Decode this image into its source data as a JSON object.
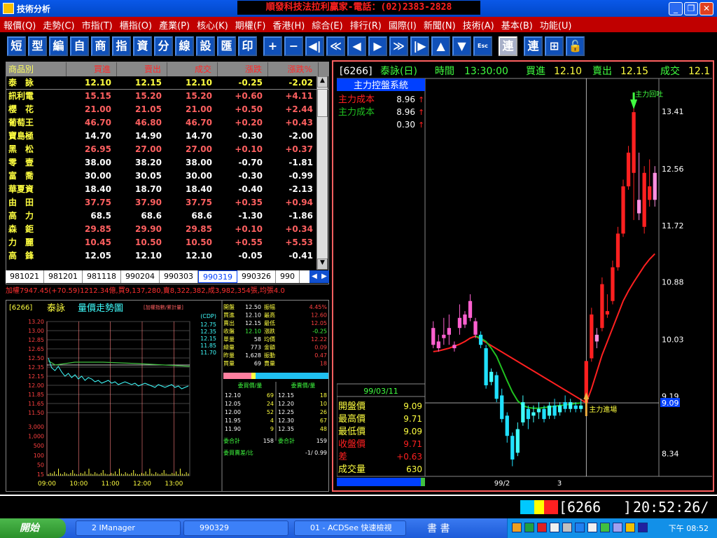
{
  "window": {
    "title": "技術分析",
    "banner": "順發科技法拉利贏家-電話：(02)2383-2828",
    "buttons": [
      "_",
      "❐",
      "✕"
    ]
  },
  "menu": [
    "報價(Q)",
    "走勢(C)",
    "市指(T)",
    "櫃指(O)",
    "產業(P)",
    "核心(K)",
    "期權(F)",
    "香港(H)",
    "綜合(E)",
    "排行(R)",
    "國際(I)",
    "新聞(N)",
    "技術(A)",
    "基本(B)",
    "功能(U)"
  ],
  "toolbar": [
    "短",
    "型",
    "編",
    "自",
    "商",
    "指",
    "資",
    "分",
    "線",
    "設",
    "匯",
    "印",
    "+",
    "−",
    "◀|",
    "≪",
    "◀",
    "▶",
    "≫",
    "|▶",
    "▲",
    "▼",
    "Esc",
    "連",
    "連",
    "⊞",
    "🔓"
  ],
  "quote_table": {
    "headers": [
      "商品別",
      "買進",
      "賣出",
      "成交",
      "漲跌",
      "漲跌%"
    ],
    "rows": [
      {
        "name": "泰　詠",
        "bid": "12.10",
        "ask": "12.15",
        "last": "12.10",
        "chg": "-0.25",
        "pct": "-2.02",
        "color": "#ffff40"
      },
      {
        "name": "訊利電",
        "bid": "15.15",
        "ask": "15.20",
        "last": "15.20",
        "chg": "+0.60",
        "pct": "+4.11",
        "color": "#ff6060"
      },
      {
        "name": "櫻　花",
        "bid": "21.00",
        "ask": "21.05",
        "last": "21.00",
        "chg": "+0.50",
        "pct": "+2.44",
        "color": "#ff6060"
      },
      {
        "name": "葡萄王",
        "bid": "46.70",
        "ask": "46.80",
        "last": "46.70",
        "chg": "+0.20",
        "pct": "+0.43",
        "color": "#ff6060"
      },
      {
        "name": "寶島極",
        "bid": "14.70",
        "ask": "14.90",
        "last": "14.70",
        "chg": "-0.30",
        "pct": "-2.00",
        "color": "#ffffff"
      },
      {
        "name": "黑　松",
        "bid": "26.95",
        "ask": "27.00",
        "last": "27.00",
        "chg": "+0.10",
        "pct": "+0.37",
        "color": "#ff6060"
      },
      {
        "name": "零　壹",
        "bid": "38.00",
        "ask": "38.20",
        "last": "38.00",
        "chg": "-0.70",
        "pct": "-1.81",
        "color": "#ffffff"
      },
      {
        "name": "富　喬",
        "bid": "30.00",
        "ask": "30.05",
        "last": "30.00",
        "chg": "-0.30",
        "pct": "-0.99",
        "color": "#ffffff"
      },
      {
        "name": "華夏資",
        "bid": "18.40",
        "ask": "18.70",
        "last": "18.40",
        "chg": "-0.40",
        "pct": "-2.13",
        "color": "#ffffff"
      },
      {
        "name": "由　田",
        "bid": "37.75",
        "ask": "37.90",
        "last": "37.75",
        "chg": "+0.35",
        "pct": "+0.94",
        "color": "#ff6060"
      },
      {
        "name": "高　力",
        "bid": "68.5",
        "ask": "68.6",
        "last": "68.6",
        "chg": "-1.30",
        "pct": "-1.86",
        "color": "#ffffff"
      },
      {
        "name": "森　鉅",
        "bid": "29.85",
        "ask": "29.90",
        "last": "29.85",
        "chg": "+0.10",
        "pct": "+0.34",
        "color": "#ff6060"
      },
      {
        "name": "力　麗",
        "bid": "10.45",
        "ask": "10.50",
        "last": "10.50",
        "chg": "+0.55",
        "pct": "+5.53",
        "color": "#ff6060"
      },
      {
        "name": "高　鋒",
        "bid": "12.05",
        "ask": "12.10",
        "last": "12.10",
        "chg": "-0.05",
        "pct": "-0.41",
        "color": "#ffffff"
      }
    ]
  },
  "date_tabs": [
    "981021",
    "981201",
    "981118",
    "990204",
    "990303",
    "990319",
    "990326",
    "990"
  ],
  "active_tab": "990319",
  "ticker_line": "加權7947.45(+70.59)1212.34億,買9,137,280,賣8,322,382,成3,982,354張,均張4.0",
  "tick_chart": {
    "code": "[6266]",
    "name": "泰詠",
    "title": "量價走勢圖",
    "subtitle": "[加權指數/累計量]",
    "cdp_label": "(CDP)",
    "cdp_values": [
      "12.75",
      "12.35",
      "12.15",
      "11.85",
      "11.70"
    ],
    "price_ticks": [
      "13.20",
      "13.00",
      "12.85",
      "12.65",
      "12.50",
      "12.35",
      "12.15",
      "12.00",
      "11.85",
      "11.65",
      "11.50"
    ],
    "volume_ticks": [
      "3,000",
      "1,000",
      "500",
      "100",
      "50",
      "15"
    ],
    "time_ticks": [
      "09:00",
      "10:00",
      "11:00",
      "12:00",
      "13:00"
    ],
    "stats": [
      [
        "開盤",
        "12.50",
        "振幅",
        "4.45%"
      ],
      [
        "買進",
        "12.10",
        "最高",
        "12.60"
      ],
      [
        "賣出",
        "12.15",
        "最低",
        "12.05"
      ],
      [
        "收盤",
        "12.10",
        "漲跌",
        "-0.25"
      ],
      [
        "單量",
        "58",
        "均價",
        "12.22"
      ],
      [
        "總量",
        "773",
        "金額",
        "0.09"
      ],
      [
        "昨量",
        "1,628",
        "振動",
        "0.47"
      ],
      [
        "買量",
        "",
        "賣量",
        "18"
      ]
    ],
    "buy_vol": "69",
    "bid_header": "委買價/量",
    "ask_header": "委賣價/量",
    "book": [
      [
        "12.10",
        "69",
        "12.15",
        "18"
      ],
      [
        "12.05",
        "24",
        "12.20",
        "10"
      ],
      [
        "12.00",
        "52",
        "12.25",
        "26"
      ],
      [
        "11.95",
        "4",
        "12.30",
        "67"
      ],
      [
        "11.90",
        "9",
        "12.35",
        "48"
      ]
    ],
    "bid_total_label": "委合計",
    "bid_total": "158",
    "ask_total_label": "委合計",
    "ask_total": "159",
    "ratio_label": "委買賣差/比",
    "ratio": "-1/ 0.99"
  },
  "kline": {
    "header": {
      "code": "[6266]",
      "name": "泰詠(日)",
      "time_label": "時間",
      "time": "13:30:00",
      "bid_label": "買進",
      "bid": "12.10",
      "ask_label": "賣出",
      "ask": "12.15",
      "last_label": "成交",
      "last": "12.1"
    },
    "system_title": "主力控盤系統",
    "legend": [
      {
        "label": "主力成本",
        "value": "8.96",
        "color": "#ff2020"
      },
      {
        "label": "主力成本",
        "value": "8.96",
        "color": "#20c020"
      },
      {
        "label": "",
        "value": "0.30",
        "color": "#ff2020"
      }
    ],
    "price_axis": [
      "13.41",
      "12.56",
      "11.72",
      "10.88",
      "10.03",
      "9.19",
      "9.09",
      "8.34"
    ],
    "current_price": "9.09",
    "annotations": {
      "return": "主力回吐",
      "entry": "主力進場"
    },
    "x_axis": [
      "99/2",
      "3"
    ],
    "info_date": "99/03/11",
    "info": [
      {
        "label": "開盤價",
        "value": "9.09",
        "lcolor": "#ffff40"
      },
      {
        "label": "最高價",
        "value": "9.71",
        "lcolor": "#ffff40"
      },
      {
        "label": "最低價",
        "value": "9.09",
        "lcolor": "#ffff40"
      },
      {
        "label": "收盤價",
        "value": "9.71",
        "lcolor": "#ff2020"
      },
      {
        "label": "差",
        "value": "+0.63",
        "lcolor": "#ff2020"
      },
      {
        "label": "成交量",
        "value": "630",
        "lcolor": "#ffff40"
      }
    ]
  },
  "chart_data": {
    "type": "candlestick",
    "title": "泰詠(日)",
    "xlabel": "",
    "ylabel": "",
    "ylim": [
      8.0,
      13.9
    ],
    "x_ticks": [
      "99/2",
      "3"
    ],
    "candles": [
      {
        "o": 10.2,
        "h": 10.3,
        "l": 9.9,
        "c": 9.95
      },
      {
        "o": 10.0,
        "h": 10.1,
        "l": 9.85,
        "c": 9.9
      },
      {
        "o": 10.05,
        "h": 10.35,
        "l": 9.95,
        "c": 10.1
      },
      {
        "o": 10.1,
        "h": 10.4,
        "l": 9.95,
        "c": 10.2
      },
      {
        "o": 9.95,
        "h": 10.0,
        "l": 9.85,
        "c": 9.9
      },
      {
        "o": 10.2,
        "h": 10.55,
        "l": 10.1,
        "c": 10.35
      },
      {
        "o": 10.4,
        "h": 10.45,
        "l": 10.2,
        "c": 10.25
      },
      {
        "o": 10.35,
        "h": 10.7,
        "l": 10.3,
        "c": 10.6
      },
      {
        "o": 10.3,
        "h": 10.35,
        "l": 10.05,
        "c": 10.1
      },
      {
        "o": 10.1,
        "h": 10.15,
        "l": 9.9,
        "c": 9.95
      },
      {
        "o": 9.9,
        "h": 9.95,
        "l": 9.3,
        "c": 9.35
      },
      {
        "o": 9.4,
        "h": 9.6,
        "l": 9.35,
        "c": 9.55
      },
      {
        "o": 9.5,
        "h": 9.55,
        "l": 9.1,
        "c": 9.15
      },
      {
        "o": 9.2,
        "h": 9.3,
        "l": 8.8,
        "c": 8.85
      },
      {
        "o": 8.9,
        "h": 8.95,
        "l": 8.5,
        "c": 8.6
      },
      {
        "o": 8.6,
        "h": 8.65,
        "l": 8.15,
        "c": 8.25
      },
      {
        "o": 8.35,
        "h": 8.8,
        "l": 8.3,
        "c": 8.7
      },
      {
        "o": 8.8,
        "h": 9.2,
        "l": 8.75,
        "c": 9.1
      },
      {
        "o": 9.0,
        "h": 9.05,
        "l": 8.7,
        "c": 8.85
      },
      {
        "o": 8.9,
        "h": 9.05,
        "l": 8.8,
        "c": 8.95
      },
      {
        "o": 8.95,
        "h": 9.1,
        "l": 8.85,
        "c": 9.0
      },
      {
        "o": 9.0,
        "h": 9.05,
        "l": 8.8,
        "c": 8.85
      },
      {
        "o": 8.9,
        "h": 9.1,
        "l": 8.85,
        "c": 9.05
      },
      {
        "o": 9.05,
        "h": 9.15,
        "l": 8.85,
        "c": 8.9
      },
      {
        "o": 8.95,
        "h": 9.1,
        "l": 8.9,
        "c": 9.05
      },
      {
        "o": 9.1,
        "h": 9.2,
        "l": 8.95,
        "c": 9.0
      },
      {
        "o": 9.0,
        "h": 9.15,
        "l": 8.95,
        "c": 9.1
      },
      {
        "o": 9.05,
        "h": 9.1,
        "l": 8.95,
        "c": 9.0
      },
      {
        "o": 9.0,
        "h": 9.15,
        "l": 8.95,
        "c": 9.05
      },
      {
        "o": 9.09,
        "h": 9.71,
        "l": 9.09,
        "c": 9.71
      },
      {
        "o": 9.75,
        "h": 10.5,
        "l": 9.7,
        "c": 10.4
      },
      {
        "o": 10.1,
        "h": 10.2,
        "l": 9.9,
        "c": 10.0
      },
      {
        "o": 10.2,
        "h": 10.95,
        "l": 10.15,
        "c": 10.85
      },
      {
        "o": 10.4,
        "h": 10.7,
        "l": 10.35,
        "c": 10.45
      },
      {
        "o": 10.6,
        "h": 11.2,
        "l": 10.55,
        "c": 11.1
      },
      {
        "o": 11.1,
        "h": 11.7,
        "l": 11.05,
        "c": 11.6
      },
      {
        "o": 11.6,
        "h": 12.4,
        "l": 11.55,
        "c": 12.3
      },
      {
        "o": 12.3,
        "h": 12.9,
        "l": 12.25,
        "c": 12.8
      },
      {
        "o": 12.5,
        "h": 13.5,
        "l": 11.8,
        "c": 13.4
      },
      {
        "o": 12.1,
        "h": 12.8,
        "l": 11.8,
        "c": 11.9
      },
      {
        "o": 11.7,
        "h": 12.6,
        "l": 11.6,
        "c": 12.5
      },
      {
        "o": 12.1,
        "h": 12.7,
        "l": 12.0,
        "c": 12.3
      },
      {
        "o": 12.5,
        "h": 12.6,
        "l": 12.0,
        "c": 12.1
      }
    ],
    "series": [
      {
        "name": "主力成本",
        "color": "#ff2020",
        "values": [
          9.85,
          9.86,
          9.88,
          9.9,
          9.93,
          9.96,
          10.0,
          10.05,
          10.08,
          null,
          null,
          null,
          null,
          null,
          null,
          null,
          null,
          null,
          null,
          null,
          null,
          null,
          null,
          null,
          null,
          null,
          null,
          null,
          null,
          9.09,
          9.3,
          9.55,
          9.8,
          10.0,
          10.2,
          10.4,
          10.6,
          10.75,
          10.88,
          11.0,
          11.12,
          11.22,
          11.3
        ]
      },
      {
        "name": "主力成本",
        "color": "#20c020",
        "values": [
          null,
          null,
          null,
          null,
          null,
          null,
          null,
          null,
          10.08,
          10.05,
          10.0,
          9.9,
          9.78,
          9.6,
          9.42,
          9.25,
          9.12,
          9.05,
          9.02,
          9.01,
          9.01,
          9.02,
          9.03,
          9.04,
          9.05,
          9.06,
          9.07,
          9.08,
          9.09,
          null,
          null,
          null,
          null,
          null,
          null,
          null,
          null,
          null,
          null,
          null,
          null,
          null,
          null
        ]
      }
    ]
  },
  "status_bar": {
    "code": "6266",
    "time": "20:52:26/"
  },
  "taskbar": {
    "start": "開始",
    "tasks": [
      "2 IManager",
      "990329",
      "01 - ACDSee 快速檢視"
    ],
    "ime": "書 書",
    "clock": "下午 08:52"
  }
}
